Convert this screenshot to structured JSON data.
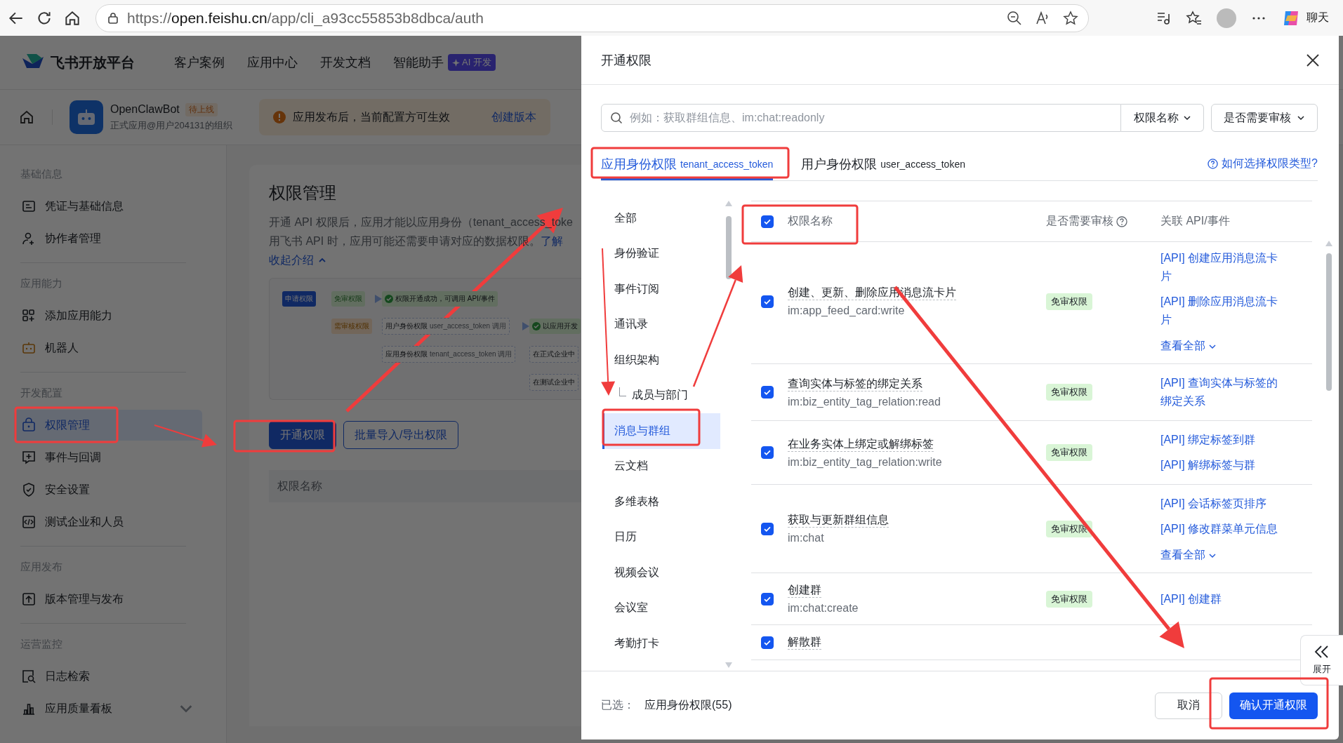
{
  "browser": {
    "url_scheme": "https://",
    "url_host": "open.feishu.cn",
    "url_path": "/app/cli_a93cc55853b8dbca/auth",
    "chat_label": "聊天"
  },
  "app_header": {
    "logo_text": "飞书开放平台",
    "nav": [
      "客户案例",
      "应用中心",
      "开发文档",
      "智能助手"
    ],
    "ai_badge": "AI 开发"
  },
  "app_bar": {
    "app_name": "OpenClawBot",
    "status_tag": "待上线",
    "org": "正式应用@用户204131的组织",
    "notice": "应用发布后，当前配置方可生效",
    "notice_link": "创建版本"
  },
  "sidebar": {
    "sections": [
      {
        "title": "基础信息",
        "items": [
          {
            "label": "凭证与基础信息",
            "selected": false
          },
          {
            "label": "协作者管理",
            "selected": false
          }
        ]
      },
      {
        "title": "应用能力",
        "items": [
          {
            "label": "添加应用能力",
            "selected": false
          },
          {
            "label": "机器人",
            "selected": false
          }
        ]
      },
      {
        "title": "开发配置",
        "items": [
          {
            "label": "权限管理",
            "selected": true
          },
          {
            "label": "事件与回调",
            "selected": false
          },
          {
            "label": "安全设置",
            "selected": false
          },
          {
            "label": "测试企业和人员",
            "selected": false
          }
        ]
      },
      {
        "title": "应用发布",
        "items": [
          {
            "label": "版本管理与发布",
            "selected": false
          }
        ]
      },
      {
        "title": "运营监控",
        "items": [
          {
            "label": "日志检索",
            "selected": false
          },
          {
            "label": "应用质量看板",
            "selected": false,
            "expandable": true
          }
        ]
      }
    ]
  },
  "content": {
    "title": "权限管理",
    "description_lines": [
      "开通 API 权限后，应用才能以应用身份（tenant_access_toke",
      "用飞书 API 时，应用可能还需要申请对应的数据权限。"
    ],
    "description_link": "了解",
    "collapse_link": "收起介绍",
    "diagram": {
      "rows": [
        {
          "start": "申请权限",
          "branch": {
            "text": "免审权限",
            "kind": "free"
          },
          "arrow_to_step": true,
          "step": {
            "text": "权限开通成功，可调用 API/事件",
            "kind": "success"
          }
        },
        {
          "branch": {
            "text": "需审核权限",
            "kind": "review"
          },
          "step": {
            "text": "用户身份权限",
            "sub": "user_access_token 调用",
            "kind": "dashed"
          },
          "arrow_to_result": true,
          "result": {
            "text": "以应用开发",
            "kind": "success"
          }
        },
        {
          "step": {
            "text": "应用身份权限",
            "sub": "tenant_access_token 调用",
            "kind": "dashed"
          },
          "result": {
            "text": "在正式企业中",
            "kind": "dashed"
          }
        },
        {
          "result": {
            "text": "在测试企业中",
            "kind": "dashed"
          }
        }
      ]
    },
    "buttons": [
      {
        "label": "开通权限",
        "kind": "primary"
      },
      {
        "label": "批量导入/导出权限",
        "kind": "outline"
      }
    ],
    "table_header": "权限名称"
  },
  "drawer": {
    "title": "开通权限",
    "search": {
      "placeholder": "例如：获取群组信息、im:chat:readonly"
    },
    "filters": [
      "权限名称",
      "是否需要审核"
    ],
    "tabs": [
      {
        "label": "应用身份权限",
        "token": "tenant_access_token",
        "selected": true
      },
      {
        "label": "用户身份权限",
        "token": "user_access_token",
        "selected": false
      }
    ],
    "help_link": "如何选择权限类型?",
    "categories": [
      {
        "label": "全部",
        "selected": false
      },
      {
        "label": "身份验证",
        "selected": false
      },
      {
        "label": "事件订阅",
        "selected": false
      },
      {
        "label": "通讯录",
        "selected": false
      },
      {
        "label": "组织架构",
        "selected": false,
        "children": [
          {
            "label": "成员与部门",
            "selected": false
          }
        ]
      },
      {
        "label": "消息与群组",
        "selected": true
      },
      {
        "label": "云文档",
        "selected": false
      },
      {
        "label": "多维表格",
        "selected": false
      },
      {
        "label": "日历",
        "selected": false
      },
      {
        "label": "视频会议",
        "selected": false
      },
      {
        "label": "会议室",
        "selected": false
      },
      {
        "label": "考勤打卡",
        "selected": false
      }
    ],
    "table": {
      "header_checked": true,
      "columns": [
        "权限名称",
        "是否需要审核",
        "关联 API/事件"
      ],
      "rows": [
        {
          "checked": true,
          "name": "创建、更新、删除应用消息流卡片",
          "scope": "im:app_feed_card:write",
          "tag": "免审权限",
          "apis": [
            "[API] 创建应用消息流卡片",
            "[API] 删除应用消息流卡片"
          ],
          "more": "查看全部"
        },
        {
          "checked": true,
          "name": "查询实体与标签的绑定关系",
          "scope": "im:biz_entity_tag_relation:read",
          "tag": "免审权限",
          "apis": [
            "[API] 查询实体与标签的绑定关系"
          ]
        },
        {
          "checked": true,
          "name": "在业务实体上绑定或解绑标签",
          "scope": "im:biz_entity_tag_relation:write",
          "tag": "免审权限",
          "apis": [
            "[API] 绑定标签到群",
            "[API] 解绑标签与群"
          ]
        },
        {
          "checked": true,
          "name": "获取与更新群组信息",
          "scope": "im:chat",
          "tag": "免审权限",
          "apis": [
            "[API] 会话标签页排序",
            "[API] 修改群菜单元信息"
          ],
          "more": "查看全部"
        },
        {
          "checked": true,
          "name": "创建群",
          "scope": "im:chat:create",
          "tag": "免审权限",
          "apis": [
            "[API] 创建群"
          ]
        },
        {
          "checked": true,
          "name": "解散群"
        }
      ]
    },
    "footer": {
      "selected_label": "已选：",
      "selected_value": "应用身份权限(55)",
      "cancel": "取消",
      "confirm": "确认开通权限"
    },
    "expand_tab": {
      "label": "展开"
    }
  }
}
